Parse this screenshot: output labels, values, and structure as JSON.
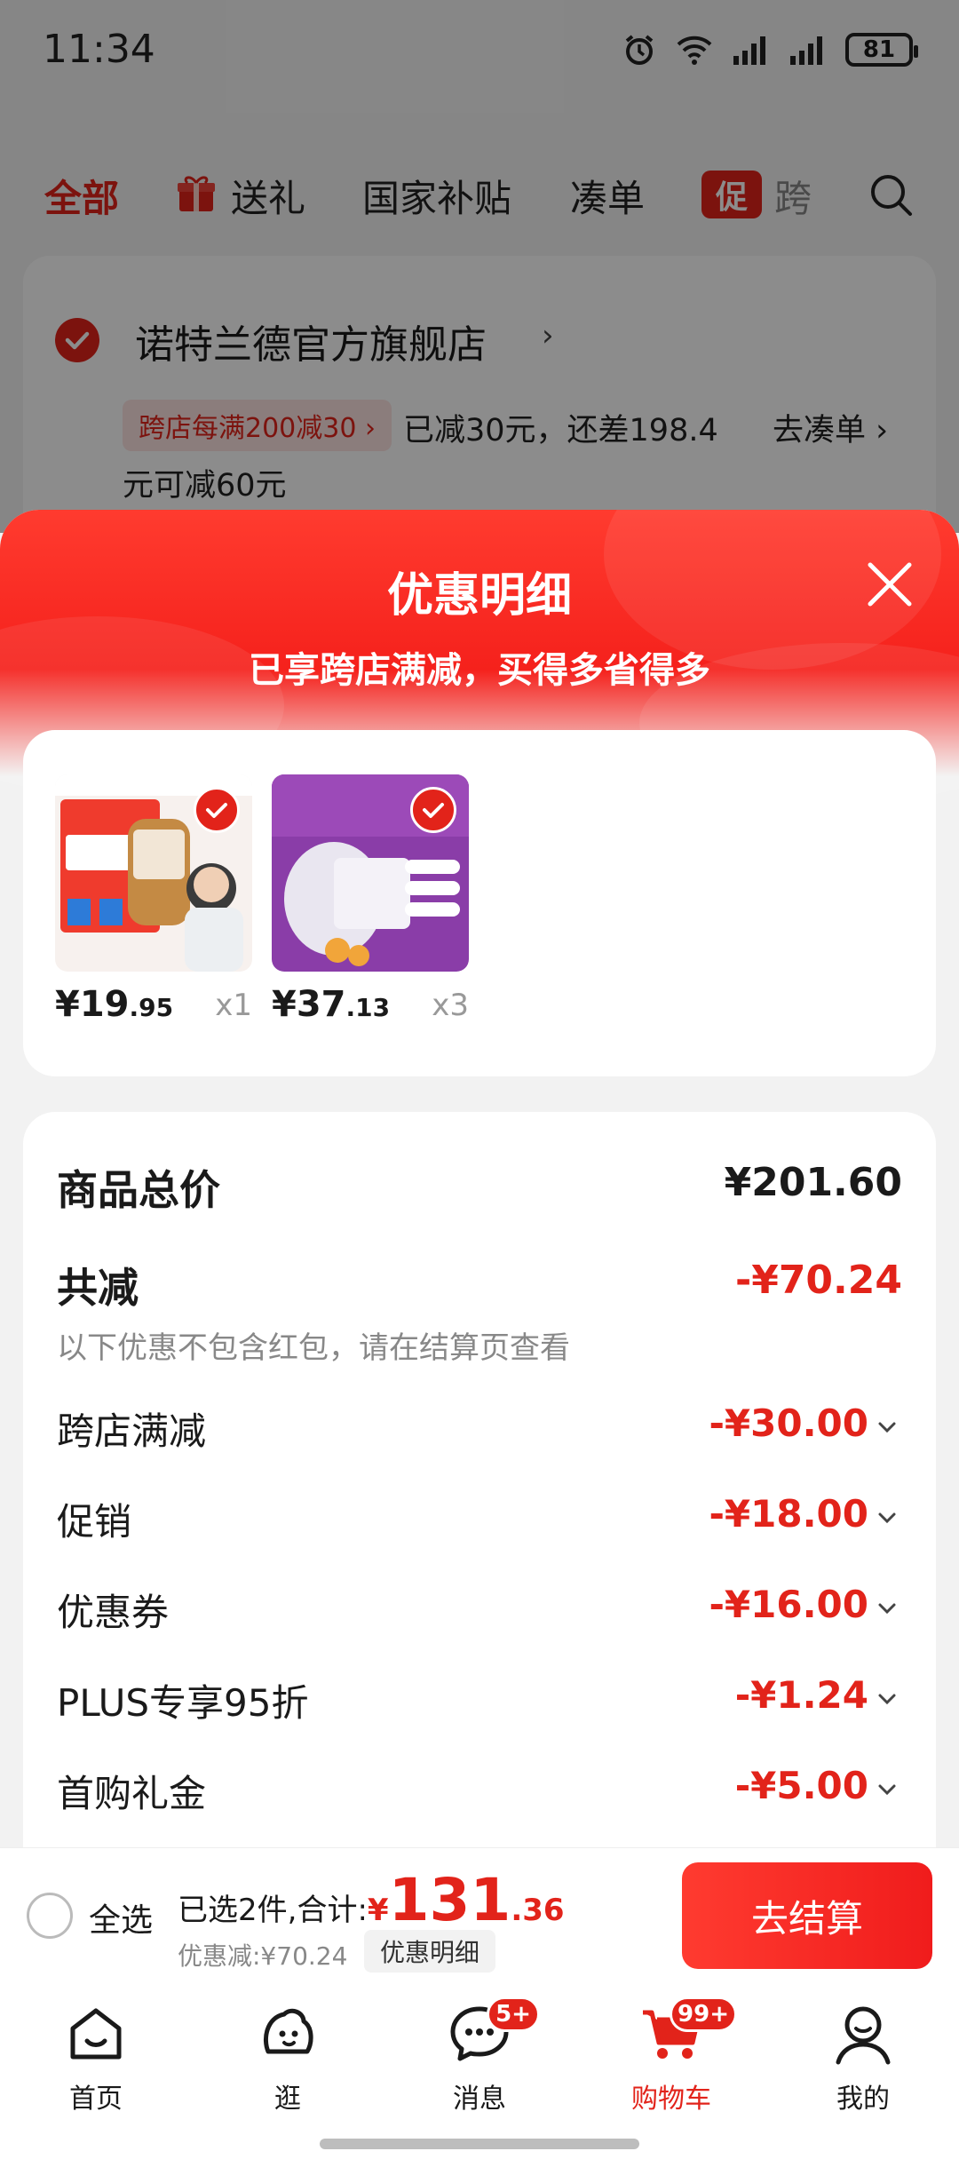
{
  "status_bar": {
    "time": "11:34",
    "battery": "81",
    "icons": [
      "alarm-icon",
      "wifi-icon",
      "signal-icon",
      "signal-icon",
      "battery-icon"
    ]
  },
  "tabs": {
    "all": "全部",
    "gift": "送礼",
    "national_subsidy": "国家补贴",
    "make_order": "凑单",
    "promo_badge": "促",
    "promo_partial": "跨"
  },
  "store": {
    "name": "诺特兰德官方旗舰店",
    "chevron": "›",
    "promo_tag": "跨店每满200减30 ›",
    "promo_text_line1": "已减30元，还差198.4",
    "promo_text_line2": "元可减60元",
    "go_make_order": "去凑单 ›"
  },
  "sheet": {
    "title": "优惠明细",
    "subtitle": "已享跨店满减，买得多省得多"
  },
  "products": [
    {
      "price_yen": "¥",
      "price_int": "19",
      "price_dec": ".95",
      "qty": "x1"
    },
    {
      "price_yen": "¥",
      "price_int": "37",
      "price_dec": ".13",
      "qty": "x3"
    }
  ],
  "details": {
    "total_label": "商品总价",
    "total_value": "¥201.60",
    "reduced_label": "共减",
    "reduced_value": "-¥70.24",
    "note": "以下优惠不包含红包，请在结算页查看",
    "rows": [
      {
        "label": "跨店满减",
        "value": "-¥30.00"
      },
      {
        "label": "促销",
        "value": "-¥18.00"
      },
      {
        "label": "优惠券",
        "value": "-¥16.00"
      },
      {
        "label": "PLUS专享95折",
        "value": "-¥1.24"
      },
      {
        "label": "首购礼金",
        "value": "-¥5.00"
      }
    ]
  },
  "checkout": {
    "select_all": "全选",
    "selected_text": "已选2件,合计:",
    "yen": "¥",
    "amount_int": "131",
    "amount_dec": ".36",
    "discount_text": "优惠减:¥70.24",
    "detail_button": "优惠明细",
    "checkout_button": "去结算"
  },
  "nav": {
    "items": [
      {
        "label": "首页",
        "icon": "home-icon"
      },
      {
        "label": "逛",
        "icon": "browse-icon"
      },
      {
        "label": "消息",
        "icon": "message-icon",
        "badge": "5+"
      },
      {
        "label": "购物车",
        "icon": "cart-icon",
        "badge": "99+"
      },
      {
        "label": "我的",
        "icon": "profile-icon"
      }
    ]
  },
  "colors": {
    "accent": "#e2231a",
    "header_gradient_top": "#ff3b2f"
  }
}
